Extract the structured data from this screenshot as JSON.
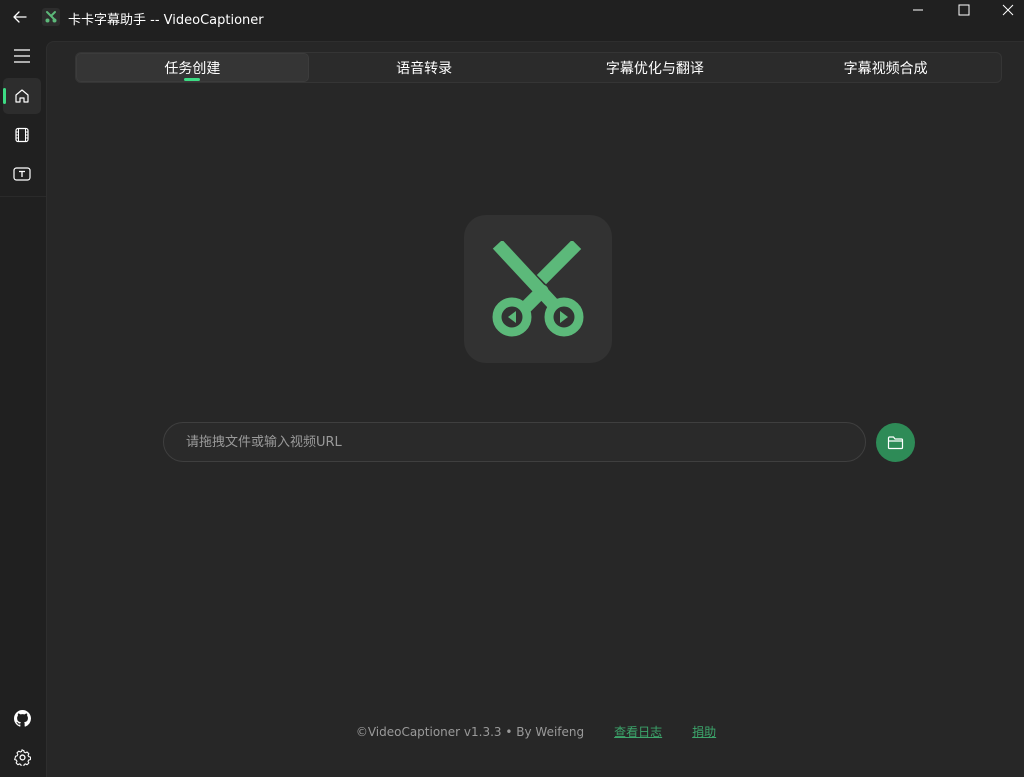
{
  "window": {
    "title": "卡卡字幕助手 -- VideoCaptioner",
    "icons": {
      "back": "arrow-left-icon",
      "app": "scissors-icon",
      "minimize": "minimize-icon",
      "maximize": "maximize-icon",
      "close": "close-icon"
    }
  },
  "sidebar": {
    "items": [
      {
        "icon": "hamburger-menu-icon",
        "active": false
      },
      {
        "icon": "home-icon",
        "active": true
      },
      {
        "icon": "film-icon",
        "active": false
      },
      {
        "icon": "text-box-icon",
        "active": false
      }
    ],
    "bottom": [
      {
        "icon": "github-icon"
      },
      {
        "icon": "gear-icon"
      }
    ]
  },
  "tabs": [
    {
      "label": "任务创建",
      "active": true
    },
    {
      "label": "语音转录",
      "active": false
    },
    {
      "label": "字幕优化与翻译",
      "active": false
    },
    {
      "label": "字幕视频合成",
      "active": false
    }
  ],
  "main": {
    "logo_icon": "scissors-icon",
    "input": {
      "placeholder": "请拖拽文件或输入视频URL",
      "value": ""
    },
    "browse_icon": "folder-icon"
  },
  "footer": {
    "copyright": "©VideoCaptioner v1.3.3 • By Weifeng",
    "log_link": "查看日志",
    "donate_link": "捐助"
  },
  "colors": {
    "accent": "#3ddc84",
    "logo_green": "#5cb97a",
    "button_green": "#2e8b57",
    "link_green": "#3ca56b",
    "background": "#202020",
    "panel": "#272727"
  }
}
